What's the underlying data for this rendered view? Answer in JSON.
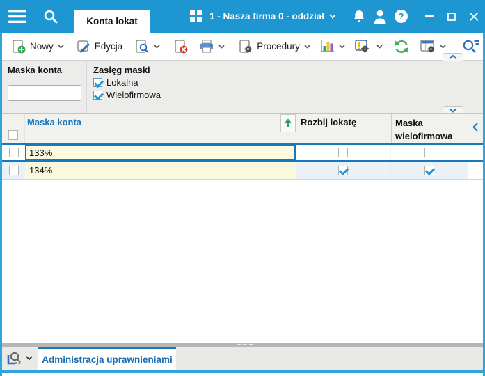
{
  "colors": {
    "titlebar_blue": "#1e96d2",
    "window_border_blue": "#31a5da",
    "selection_blue": "#1878be",
    "header_link_blue": "#1779c2",
    "edit_cell_yellow": "#fcfbe2",
    "alt_row_blue": "#eaf2f8",
    "sort_arrow_green": "#2f9e60"
  },
  "titlebar": {
    "active_tab": "Konta lokat",
    "company_selector": "1 - Nasza firma 0 - oddział"
  },
  "toolbar": {
    "new_label": "Nowy",
    "edit_label": "Edycja",
    "procedures_label": "Procedury"
  },
  "filters": {
    "account_mask": {
      "label": "Maska konta",
      "value": ""
    },
    "mask_scope": {
      "label": "Zasięg maski",
      "options": [
        {
          "label": "Lokalna",
          "checked": true
        },
        {
          "label": "Wielofirmowa",
          "checked": true
        }
      ]
    }
  },
  "grid": {
    "columns": [
      {
        "label": "Maska konta",
        "sort": "asc"
      },
      {
        "label": "Rozbij lokatę"
      },
      {
        "label": "Maska wielofirmowa"
      }
    ],
    "rows": [
      {
        "maska": "133%",
        "rozbij": false,
        "wielofirmowa": false,
        "state": "selected-editing"
      },
      {
        "maska": "134%",
        "rozbij": true,
        "wielofirmowa": true,
        "state": "normal"
      }
    ]
  },
  "statusbar": {
    "active_tab": "Administracja uprawnieniami"
  },
  "icons": {
    "menu": "≡",
    "global-search": "🔍",
    "apps-grid": "⊞",
    "notifications": "🔔",
    "user": "👤",
    "help": "?",
    "minimize": "–",
    "maximize": "□",
    "close": "×",
    "new-record": "⊕",
    "edit-record": "✎",
    "find-record": "🔍",
    "delete-record": "⊗",
    "print": "🖨",
    "procedures": "⚙",
    "chart": "📊",
    "alerts-settings": "❗⚙",
    "refresh": "⟳",
    "view-settings": "⊞⚙",
    "locator": "🔍≡",
    "lookup": "🔍",
    "dropdown": "∨",
    "collapse-up": "∧",
    "collapse-down": "∨",
    "collapse-left": "❮",
    "sort-asc": "↑"
  }
}
